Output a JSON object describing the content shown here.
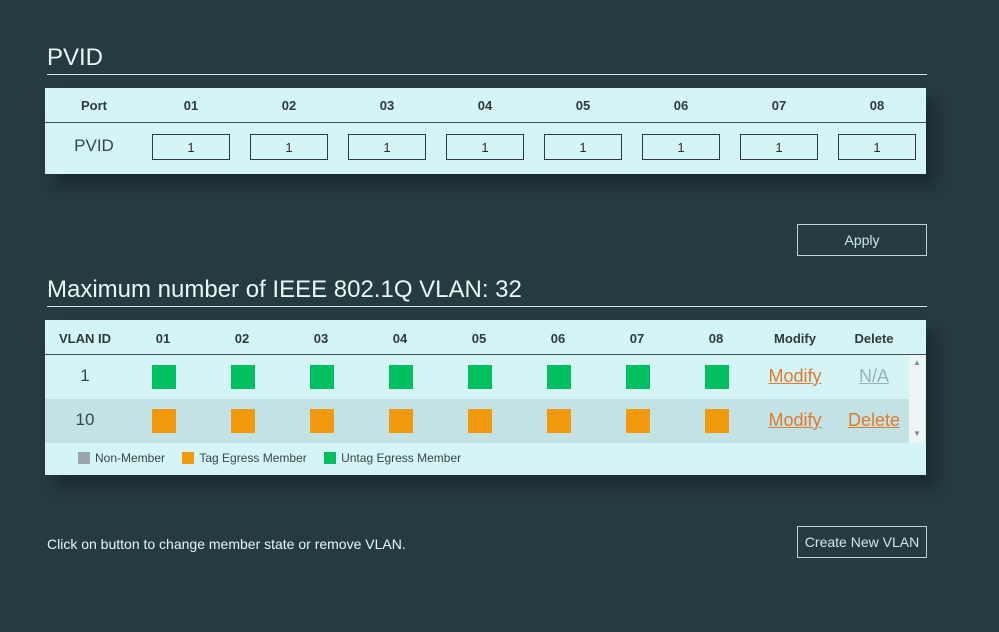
{
  "pvid_section": {
    "title": "PVID",
    "header_label": "Port",
    "row_label": "PVID",
    "ports": [
      "01",
      "02",
      "03",
      "04",
      "05",
      "06",
      "07",
      "08"
    ],
    "values": [
      "1",
      "1",
      "1",
      "1",
      "1",
      "1",
      "1",
      "1"
    ]
  },
  "apply_button": "Apply",
  "vlan_section": {
    "title": "Maximum number of IEEE 802.1Q VLAN: 32",
    "headers": {
      "vlan_id": "VLAN ID",
      "ports": [
        "01",
        "02",
        "03",
        "04",
        "05",
        "06",
        "07",
        "08"
      ],
      "modify": "Modify",
      "delete": "Delete"
    },
    "rows": [
      {
        "id": "1",
        "members": [
          "untag",
          "untag",
          "untag",
          "untag",
          "untag",
          "untag",
          "untag",
          "untag"
        ],
        "modify": "Modify",
        "delete": "N/A",
        "delete_enabled": false
      },
      {
        "id": "10",
        "members": [
          "tag",
          "tag",
          "tag",
          "tag",
          "tag",
          "tag",
          "tag",
          "tag"
        ],
        "modify": "Modify",
        "delete": "Delete",
        "delete_enabled": true
      }
    ],
    "legend": [
      {
        "label": "Non-Member",
        "color": "#9aa6aa"
      },
      {
        "label": "Tag Egress Member",
        "color": "#f19a0c"
      },
      {
        "label": "Untag Egress Member",
        "color": "#00c060"
      }
    ]
  },
  "hint_text": "Click on button to change member state or remove VLAN.",
  "create_button": "Create New VLAN",
  "colors": {
    "background": "#263a42",
    "panel": "#d5f4f5",
    "untag": "#00c060",
    "tag": "#f19a0c",
    "link": "#e07a2e"
  }
}
